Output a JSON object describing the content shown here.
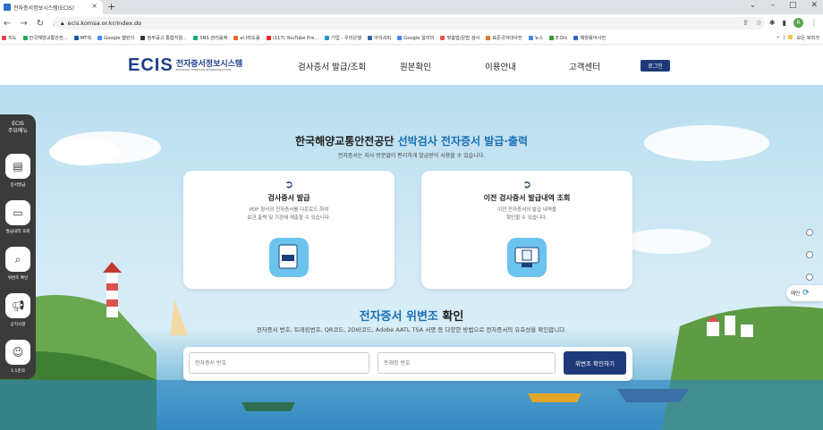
{
  "browser": {
    "tab_title": "전자증서정보시스템(ECIS)",
    "url": "ecis.komsa.or.kr/index.do",
    "profile_initial": "R",
    "bookmarks": [
      "지도",
      "한국해양교통안전...",
      "MTIS",
      "Google 캘린더",
      "정부공고 통합지원...",
      "SNS 관리음액",
      "e나라도움",
      "(117) YouTube Pre...",
      "기업 - 우리은행",
      "아이셔피",
      "Google 알리미",
      "맞춤법/문법 검사",
      "표준국어대사전",
      "뉴스",
      "E Dic",
      "해양용어사전"
    ],
    "bookmarks_more": "»",
    "other_bookmarks": "모든 북마크"
  },
  "site": {
    "logo_main": "ECIS",
    "logo_ko": "전자증서정보시스템",
    "logo_en": "ELECTRONIC CERTIFICATE INFORMATION SYSTEM",
    "menu": [
      "검사증서 발급/조회",
      "원본확인",
      "이용안내",
      "고객센터"
    ],
    "login": "로그인"
  },
  "hero": {
    "title_prefix": "한국해양교통안전공단",
    "title_highlight": "선박검사 전자증서 발급·출력",
    "subtitle": "전자증서는 지사 방문없이 편리하게 발급받아 사용할 수 있습니다."
  },
  "cards": [
    {
      "title": "검사증서 발급",
      "desc1": "PDF 형식의 전자증서를 다운로드 하여",
      "desc2": "보관,출력 및 기관에 제출할 수 있습니다.",
      "icon_label": "PDF"
    },
    {
      "title": "이전 검사증서 발급내역 조회",
      "desc1": "이전 전자증서의 발급 내역을",
      "desc2": "확인할 수 있습니다."
    }
  ],
  "verify": {
    "title_highlight": "전자증서 위변조",
    "title_suffix": "확인",
    "desc": "전자증서 번호, 트래킹번호, QR코드, 2D바코드, Adobe AATL TSA 서명 등 다양한 방법으로 전자증서의 유효성을 확인합니다.",
    "cert_placeholder": "전자증서 번호",
    "tracking_placeholder": "트래킹 번호",
    "button": "위변조 확인하기"
  },
  "sidebar": {
    "title1": "ECIS",
    "title2": "주요메뉴",
    "items": [
      "증서발급",
      "발급내역 조회",
      "위변조 확인",
      "공지사항",
      "1:1문의"
    ]
  },
  "right_widget": "메인"
}
